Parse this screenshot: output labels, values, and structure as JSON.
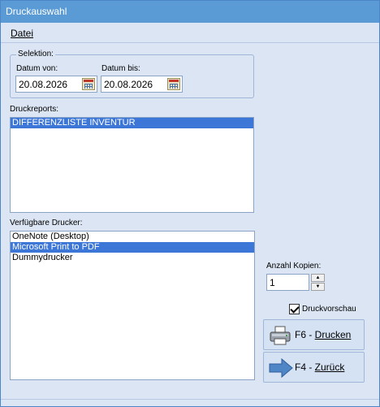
{
  "window": {
    "title": "Druckauswahl"
  },
  "menu": {
    "file_label": "Datei"
  },
  "selection": {
    "group_title": "Selektion:",
    "date_from_label": "Datum von:",
    "date_from_value": "20.08.2026",
    "date_to_label": "Datum bis:",
    "date_to_value": "20.08.2026"
  },
  "reports": {
    "label": "Druckreports:",
    "items": [
      {
        "label": "DIFFERENZLISTE INVENTUR",
        "selected": true
      }
    ]
  },
  "printers": {
    "label": "Verfügbare Drucker:",
    "items": [
      {
        "label": "OneNote (Desktop)",
        "selected": false
      },
      {
        "label": "Microsoft Print to PDF",
        "selected": true
      },
      {
        "label": "Dummydrucker",
        "selected": false
      }
    ]
  },
  "copies": {
    "label": "Anzahl Kopien:",
    "value": "1"
  },
  "preview": {
    "label": "Druckvorschau",
    "checked": true
  },
  "buttons": {
    "print_prefix": "F6 - ",
    "print_label": "Drucken",
    "back_prefix": "F4 - ",
    "back_label": "Zurück"
  },
  "icons": {
    "calendar": "calendar-icon",
    "printer": "printer-icon",
    "arrow": "arrow-right-icon"
  },
  "colors": {
    "titlebar": "#5b9bd5",
    "window_bg": "#dbe5f3",
    "selection": "#3c76d6"
  }
}
